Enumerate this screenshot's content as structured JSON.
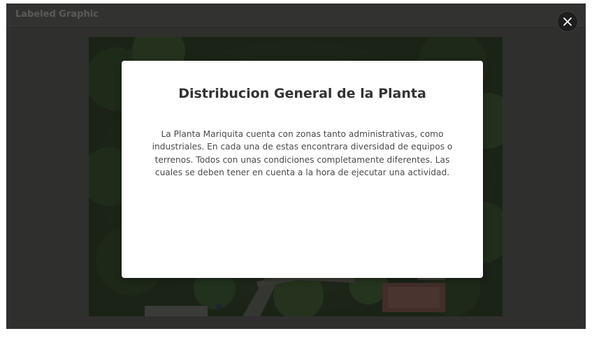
{
  "window": {
    "title": "Labeled Graphic"
  },
  "modal": {
    "title": "Distribucion General de la Planta",
    "body": "La Planta Mariquita cuenta con zonas tanto administrativas, como industriales. En cada una de estas encontrara diversidad de equipos o terrenos. Todos con unas condiciones completamente diferentes. Las cuales se deben tener en cuenta a la hora de ejecutar una actividad."
  },
  "controls": {
    "close_icon": "close-icon"
  },
  "colors": {
    "frame_background": "#2f2f2e",
    "modal_background": "#ffffff",
    "title_text": "#333333",
    "body_text": "#4a4a4a",
    "close_button": "#1e1e1e"
  }
}
